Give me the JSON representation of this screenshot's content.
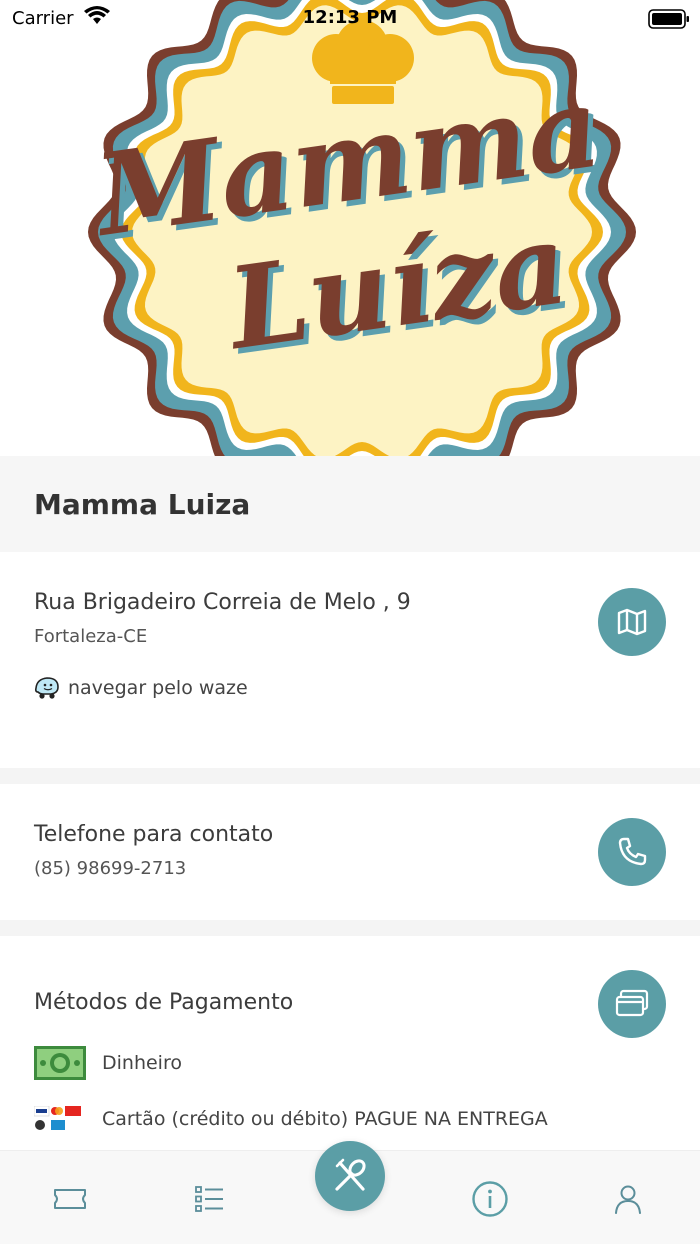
{
  "status_bar": {
    "carrier": "Carrier",
    "time": "12:13 PM"
  },
  "logo": {
    "line1": "Mamma",
    "line2": "Luíza"
  },
  "restaurant": {
    "name": "Mamma Luiza"
  },
  "address": {
    "street": "Rua Brigadeiro Correia de Melo , 9",
    "city": "Fortaleza-CE",
    "waze_label": "navegar pelo waze"
  },
  "contact": {
    "title": "Telefone para contato",
    "phone": "(85) 98699-2713"
  },
  "payment": {
    "title": "Métodos de Pagamento",
    "methods": [
      {
        "label": "Dinheiro",
        "icon": "cash-icon"
      },
      {
        "label": "Cartão (crédito ou débito) PAGUE NA ENTREGA",
        "icon": "cards-icon"
      }
    ]
  },
  "tabs": [
    {
      "name": "tickets",
      "icon": "ticket-icon"
    },
    {
      "name": "orders",
      "icon": "list-icon"
    },
    {
      "name": "menu",
      "icon": "fork-spoon-icon"
    },
    {
      "name": "info",
      "icon": "info-icon"
    },
    {
      "name": "profile",
      "icon": "user-icon"
    }
  ],
  "colors": {
    "accent": "#5b9ea6",
    "logo_brown": "#7a3e2e",
    "logo_teal": "#5c9fae",
    "logo_yellow": "#f1b51c",
    "logo_cream": "#fdf3c4"
  }
}
